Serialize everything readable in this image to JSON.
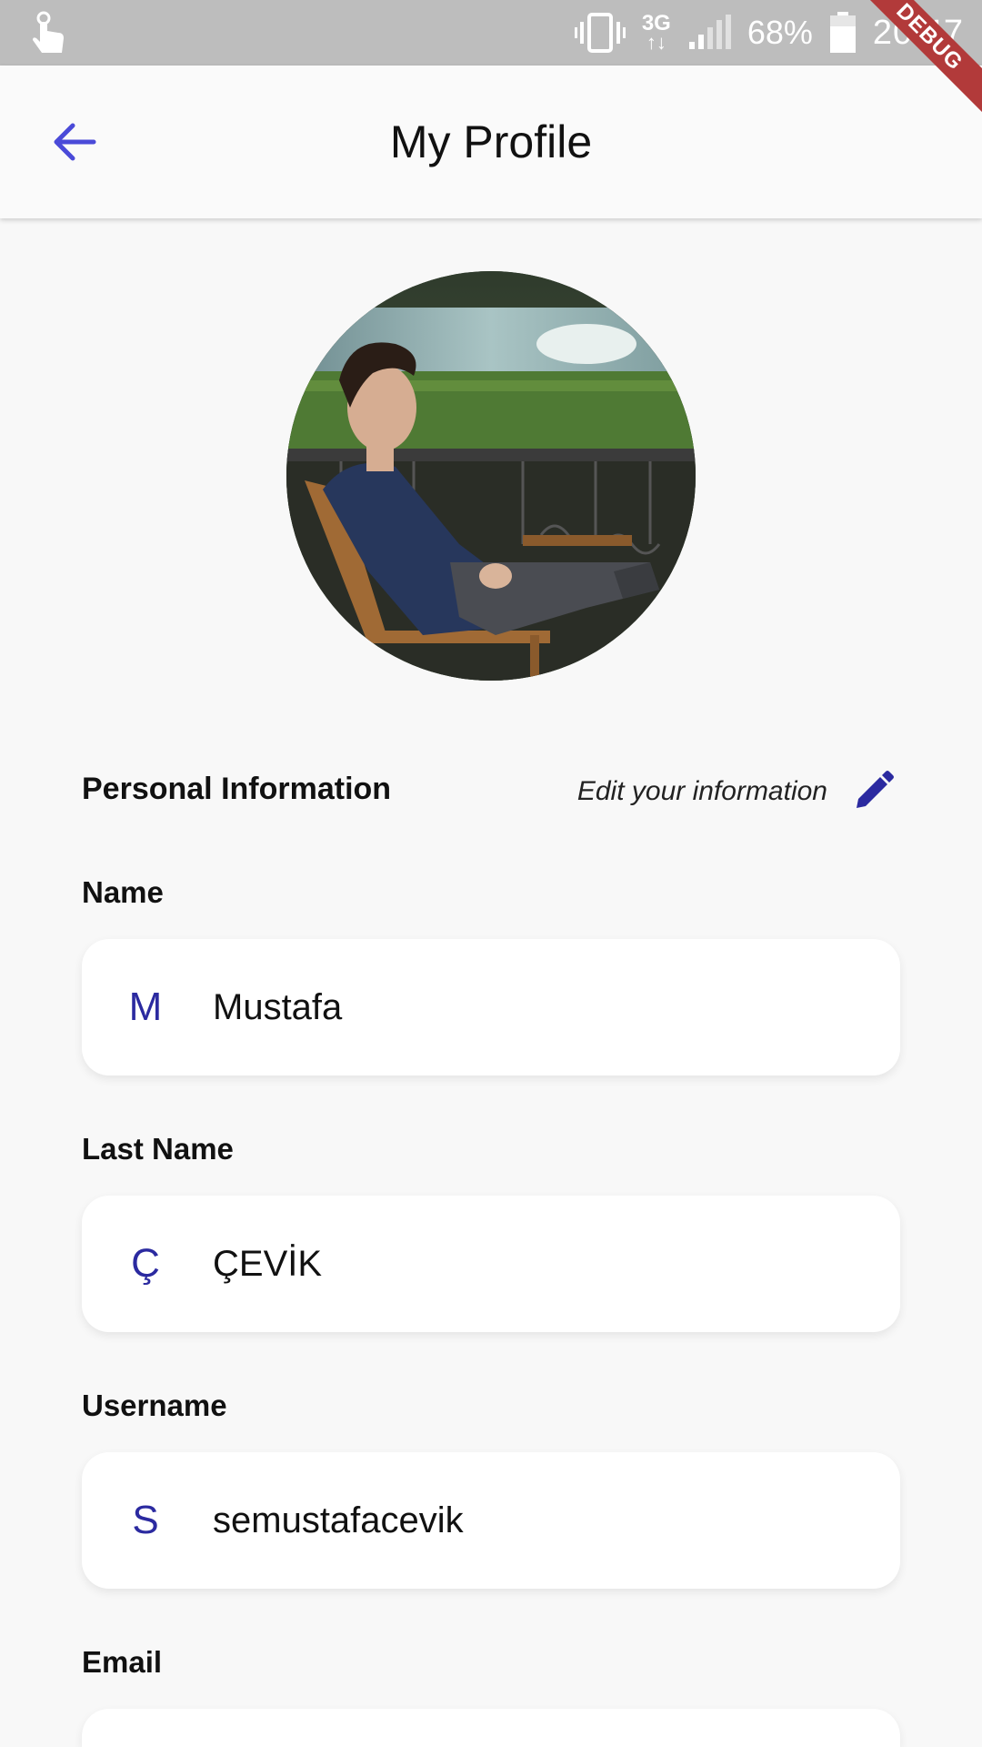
{
  "status_bar": {
    "network_type": "3G",
    "network_arrows": "↑↓",
    "battery": "68%",
    "time": "20:47"
  },
  "debug_banner": "DEBUG",
  "app_bar": {
    "title": "My Profile"
  },
  "section": {
    "title": "Personal Information",
    "edit_label": "Edit your information"
  },
  "fields": [
    {
      "label": "Name",
      "initial": "M",
      "value": "Mustafa"
    },
    {
      "label": "Last Name",
      "initial": "Ç",
      "value": "ÇEVİK"
    },
    {
      "label": "Username",
      "initial": "S",
      "value": "semustafacevik"
    },
    {
      "label": "Email",
      "initial": "",
      "value": ""
    }
  ],
  "colors": {
    "accent": "#2b2aa0",
    "back_arrow": "#4a4ad8",
    "status_bar": "#bdbdbd",
    "background": "#f8f8f8"
  },
  "icons": {
    "back": "arrow-back-icon",
    "edit": "pencil-icon",
    "touch": "touch-icon",
    "vibrate": "vibrate-icon",
    "signal": "signal-icon",
    "battery": "battery-icon"
  }
}
